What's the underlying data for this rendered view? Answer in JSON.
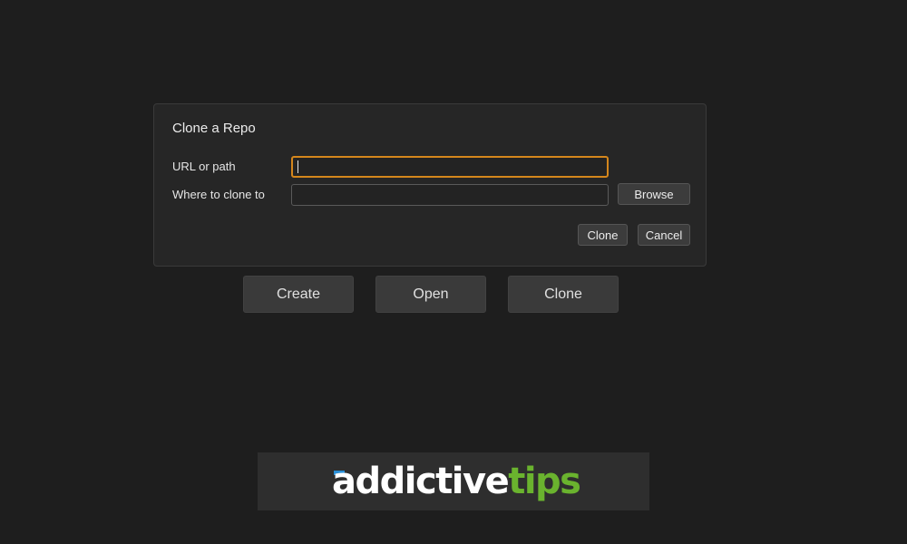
{
  "dialog": {
    "title": "Clone a Repo",
    "url_label": "URL or path",
    "url_value": "",
    "dest_label": "Where to clone to",
    "dest_value": "",
    "browse_label": "Browse",
    "clone_label": "Clone",
    "cancel_label": "Cancel"
  },
  "actions": {
    "create_label": "Create",
    "open_label": "Open",
    "clone_label": "Clone"
  },
  "logo": {
    "part1": "addictive",
    "part2": "tips",
    "colors": {
      "primary": "#ffffff",
      "accent": "#6ab32e",
      "mark": "#2a8fd6"
    }
  },
  "theme": {
    "background": "#1e1e1e",
    "focus_border": "#d4861c"
  }
}
